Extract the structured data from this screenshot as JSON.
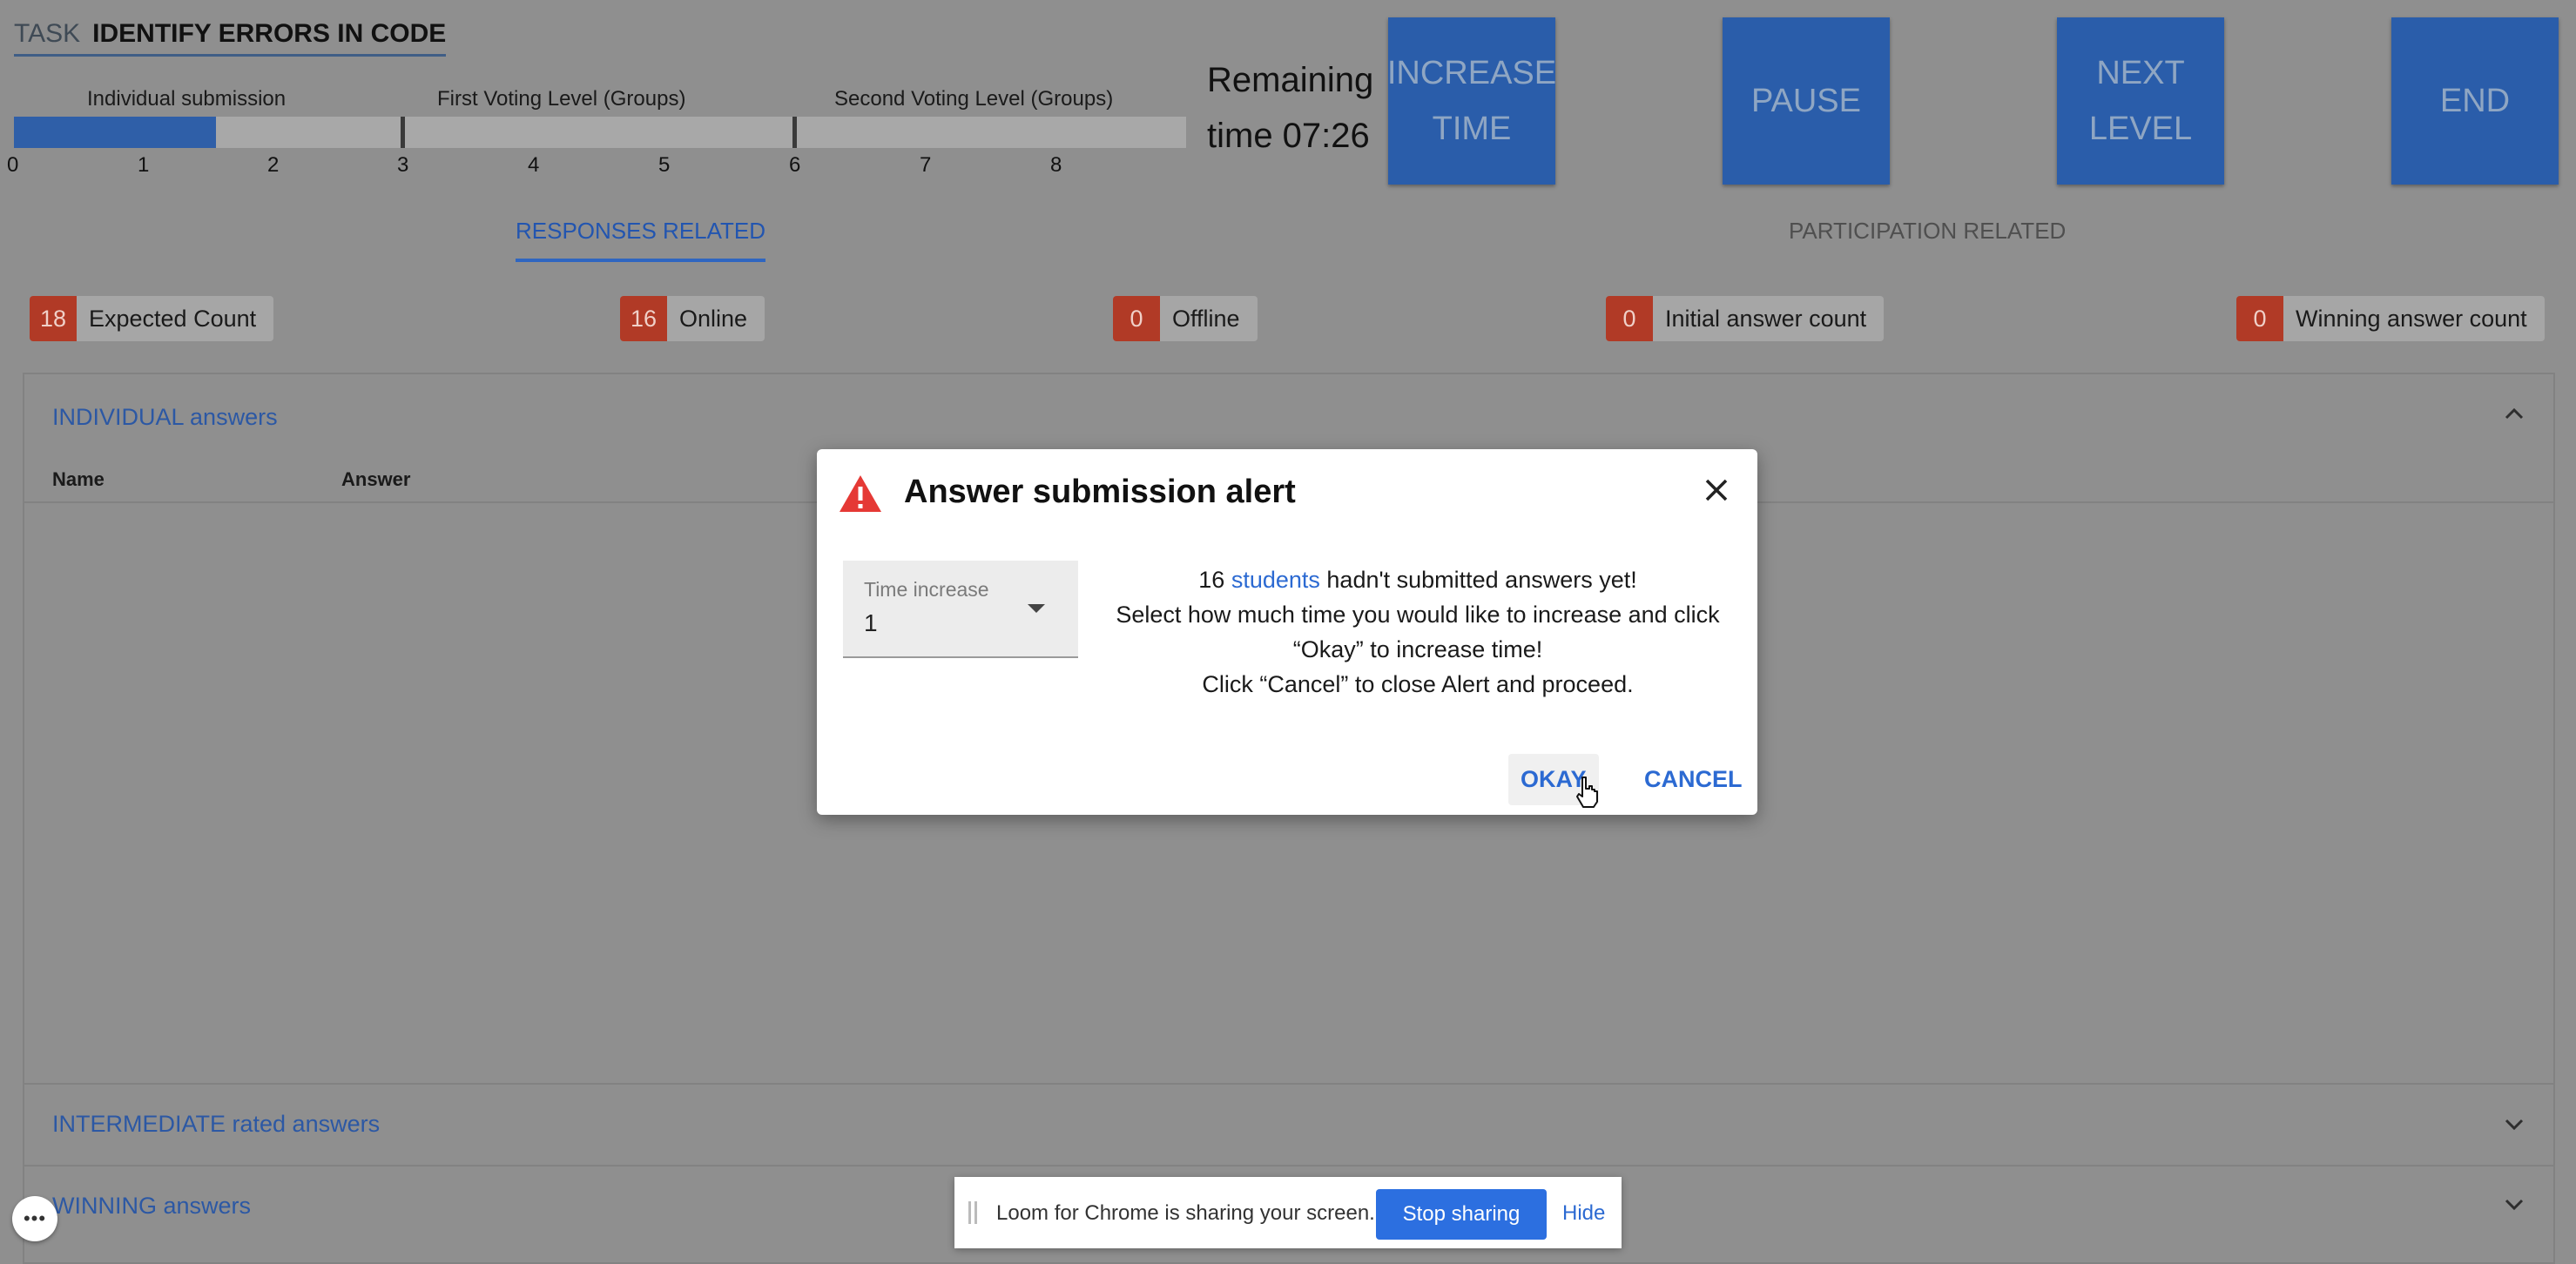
{
  "header": {
    "task_prefix": "TASK",
    "task_name": "IDENTIFY ERRORS IN CODE"
  },
  "progress": {
    "stages": [
      "Individual submission",
      "First Voting Level (Groups)",
      "Second Voting Level (Groups)"
    ],
    "ticks": [
      "0",
      "1",
      "2",
      "3",
      "4",
      "5",
      "6",
      "7",
      "8"
    ],
    "current_value": 1.55,
    "max_value": 9,
    "fill_color": "#2f5fa8"
  },
  "remaining": {
    "line1": "Remaining",
    "line2": "time 07:26"
  },
  "controls": {
    "increase_l1": "INCREASE",
    "increase_l2": "TIME",
    "pause": "PAUSE",
    "next_l1": "NEXT",
    "next_l2": "LEVEL",
    "end": "END"
  },
  "tabs": {
    "responses": "RESPONSES RELATED",
    "participation": "PARTICIPATION RELATED"
  },
  "stats": [
    {
      "count": "18",
      "label": "Expected Count"
    },
    {
      "count": "16",
      "label": "Online"
    },
    {
      "count": "0",
      "label": "Offline"
    },
    {
      "count": "0",
      "label": "Initial answer count"
    },
    {
      "count": "0",
      "label": "Winning answer count"
    }
  ],
  "panels": {
    "individual_title": "INDIVIDUAL answers",
    "col_name": "Name",
    "col_answer": "Answer",
    "intermediate_title": "INTERMEDIATE rated answers",
    "winning_title": "WINNING answers"
  },
  "modal": {
    "title": "Answer submission alert",
    "select_label": "Time increase",
    "select_value": "1",
    "msg_count": "16",
    "msg_link": "students",
    "msg_rest": "hadn't submitted answers yet!",
    "msg_line2": "Select how much time you would like to increase and click",
    "msg_line3": "“Okay” to increase time!",
    "msg_line4": "Click “Cancel” to close Alert and proceed.",
    "okay": "OKAY",
    "cancel": "CANCEL"
  },
  "loom": {
    "text": "Loom for Chrome is sharing your screen.",
    "stop": "Stop sharing",
    "hide": "Hide"
  },
  "colors": {
    "accent": "#2c6ad2",
    "badge": "#b13a26",
    "warning": "#e53935"
  }
}
